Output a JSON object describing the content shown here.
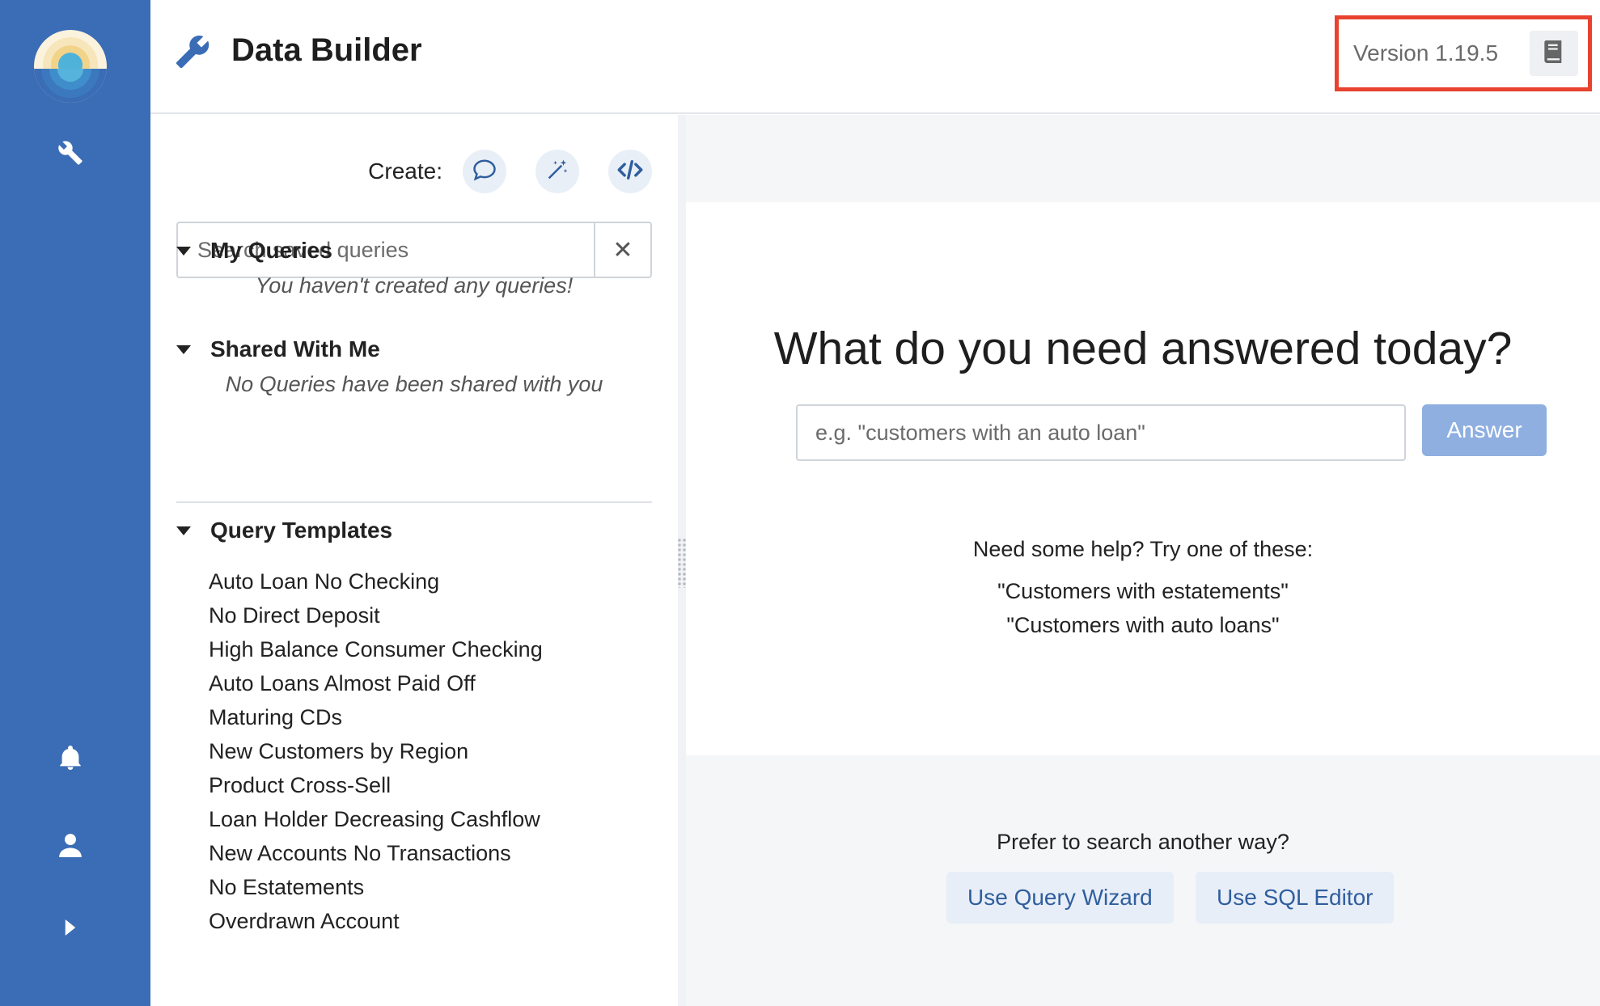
{
  "app": {
    "title": "Data Builder",
    "version": "Version 1.19.5"
  },
  "sidebar": {
    "icons": [
      "app-logo",
      "wrench-icon",
      "bell-icon",
      "user-icon",
      "chevron-right-icon"
    ]
  },
  "create": {
    "label": "Create:",
    "buttons": [
      "chat-bubble-icon",
      "magic-wand-icon",
      "code-icon"
    ]
  },
  "search": {
    "placeholder": "Search saved queries",
    "clear": "✕"
  },
  "my_queries": {
    "title": "My Queries",
    "empty": "You haven't created any queries!"
  },
  "shared": {
    "title": "Shared With Me",
    "empty": "No Queries have been shared with you"
  },
  "templates": {
    "title": "Query Templates",
    "items": [
      "Auto Loan No Checking",
      "No Direct Deposit",
      "High Balance Consumer Checking",
      "Auto Loans Almost Paid Off",
      "Maturing CDs",
      "New Customers by Region",
      "Product Cross-Sell",
      "Loan Holder Decreasing Cashflow",
      "New Accounts No Transactions",
      "No Estatements",
      "Overdrawn Account"
    ]
  },
  "main": {
    "question": "What do you need answered today?",
    "input_placeholder": "e.g. \"customers with an auto loan\"",
    "answer_label": "Answer",
    "help_title": "Need some help? Try one of these:",
    "examples": [
      "\"Customers with estatements\"",
      "\"Customers with auto loans\""
    ],
    "prefer": "Prefer to search another way?",
    "wizard_label": "Use Query Wizard",
    "sql_label": "Use SQL Editor"
  },
  "colors": {
    "sidebar": "#3a6db5",
    "accent": "#2f5e9e",
    "answer_button": "#8eafe0",
    "highlight_border": "#e8432e"
  }
}
